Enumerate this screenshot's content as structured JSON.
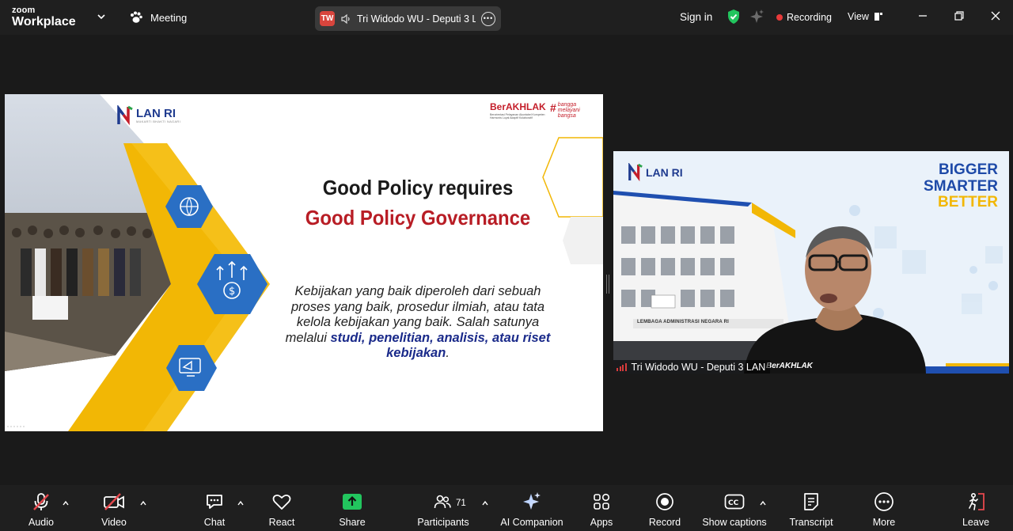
{
  "app": {
    "brand_top": "zoom",
    "brand_bottom": "Workplace",
    "meeting_label": "Meeting"
  },
  "active_speaker": {
    "initials": "TW",
    "name": "Tri Widodo WU - Deputi 3 L..."
  },
  "header": {
    "sign_in": "Sign in",
    "recording": "Recording",
    "view": "View"
  },
  "slide": {
    "logo_text": "LAN RI",
    "logo_subtext": "MAKARTI BHAKTI NAGARI",
    "berakhlak": "BerAKHLAK",
    "berakhlak_sub": "Berorientasi Pelayanan Akuntabel Kompeten Harmonis Loyal Adaptif Kolaboratif",
    "bangga": "bangga melayani bangsa",
    "title_line1": "Good Policy requires",
    "title_line2": "Good Policy Governance",
    "body_plain": "Kebijakan yang baik diperoleh dari sebuah proses yang baik, prosedur ilmiah, atau tata kelola kebijakan yang baik. Salah satunya melalui ",
    "body_highlight": "studi, penelitian, analisis, atau riset kebijakan",
    "body_end": "."
  },
  "video": {
    "participant_name": "Tri Widodo WU - Deputi 3 LAN",
    "bg_logo": "LAN RI",
    "bg_tag1": "BIGGER",
    "bg_tag2": "SMARTER",
    "bg_tag3": "BETTER",
    "building_sign": "LEMBAGA ADMINISTRASI NEGARA RI",
    "shirt_text": "BerAKHLAK"
  },
  "toolbar": {
    "audio": "Audio",
    "video": "Video",
    "chat": "Chat",
    "react": "React",
    "share": "Share",
    "participants": "Participants",
    "participants_count": "71",
    "ai_companion": "AI Companion",
    "apps": "Apps",
    "record": "Record",
    "show_captions": "Show captions",
    "transcript": "Transcript",
    "more": "More",
    "leave": "Leave"
  },
  "colors": {
    "background": "#1a1a1a",
    "toolbar": "#1f1f1f",
    "recording_dot": "#e83a3a",
    "shield_green": "#22c55e",
    "share_green": "#22c55e",
    "mute_red": "#e5484d",
    "leave_red": "#e5484d",
    "slide_title_red": "#b81d25",
    "slide_highlight_blue": "#1a2a8a",
    "hex_blue": "#2a6fc4",
    "hex_yellow": "#f2b705"
  }
}
